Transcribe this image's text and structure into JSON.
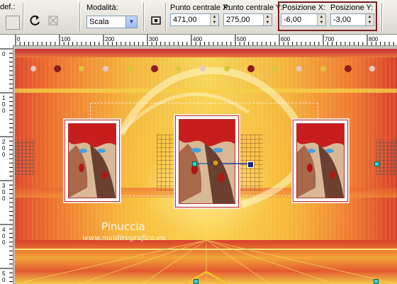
{
  "toolbar": {
    "preset_label": "def.:",
    "mode_label": "Modalità:",
    "mode_value": "Scala",
    "center_x_label": "Punto centrale X:",
    "center_x_value": "471,00",
    "center_y_label": "Punto centrale Y:",
    "center_y_value": "275,00",
    "pos_x_label": "Posizione X:",
    "pos_x_value": "-6,00",
    "pos_y_label": "Posizione Y:",
    "pos_y_value": "-3,00",
    "highlight_color": "#7a1e1e"
  },
  "ruler": {
    "top_ticks": [
      "0",
      "100",
      "200",
      "300",
      "400",
      "500",
      "600",
      "700",
      "800"
    ],
    "left_ticks": [
      "0",
      "100",
      "200",
      "300",
      "400",
      "500"
    ]
  },
  "watermark": {
    "name": "Pinuccia",
    "site": "www.maidiregrafica.eu"
  },
  "colors": {
    "accent_red": "#c62a2a",
    "accent_yellow": "#f6d65a",
    "handle_cyan": "#2dd6e0"
  }
}
